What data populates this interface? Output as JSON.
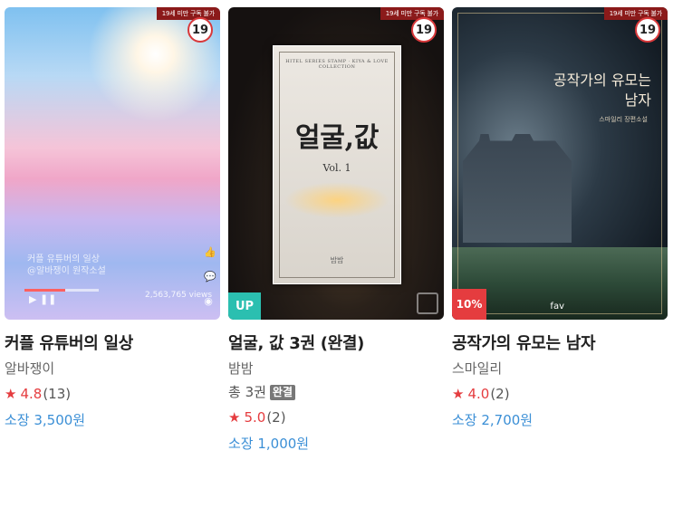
{
  "cards": [
    {
      "title": "커플 유튜버의 일상",
      "author": "알바쟁이",
      "age_badge": "19",
      "age_strip": "19세 미만 구독 불가",
      "cover_overlay": {
        "line1": "커플 유튜버의 일상",
        "line2": "@알바쟁이 원작소설",
        "views": "2,563,765 views",
        "progress": 0.55
      },
      "rating": {
        "score": "4.8",
        "count": "(13)"
      },
      "price": "소장 3,500원"
    },
    {
      "title": "얼굴, 값 3권 (완결)",
      "author": "밤밤",
      "age_badge": "19",
      "age_strip": "19세 미만 구독 불가",
      "cover_book": {
        "series": "HITEL SERIES STAMP · KIYA & LOVE COLLECTION",
        "title": "얼굴,값",
        "vol": "Vol. 1",
        "author": "밤밤"
      },
      "badge": "UP",
      "volumes": "총 3권",
      "complete_label": "완결",
      "rating": {
        "score": "5.0",
        "count": "(2)"
      },
      "price": "소장 1,000원"
    },
    {
      "title": "공작가의 유모는 남자",
      "author": "스마일리",
      "age_badge": "19",
      "age_strip": "19세 미만 구독 불가",
      "cover_title": "공작가의 유모는 남자",
      "cover_sub": "스마일리 장편소설",
      "badge": "10%",
      "fav": "fav",
      "rating": {
        "score": "4.0",
        "count": "(2)"
      },
      "price": "소장 2,700원"
    }
  ],
  "colors": {
    "accent_red": "#e53c3f",
    "price_blue": "#3b8fd6",
    "up_teal": "#2bbfb0"
  },
  "icons": {
    "star": "star-icon",
    "play": "play-icon",
    "pause": "pause-icon"
  }
}
